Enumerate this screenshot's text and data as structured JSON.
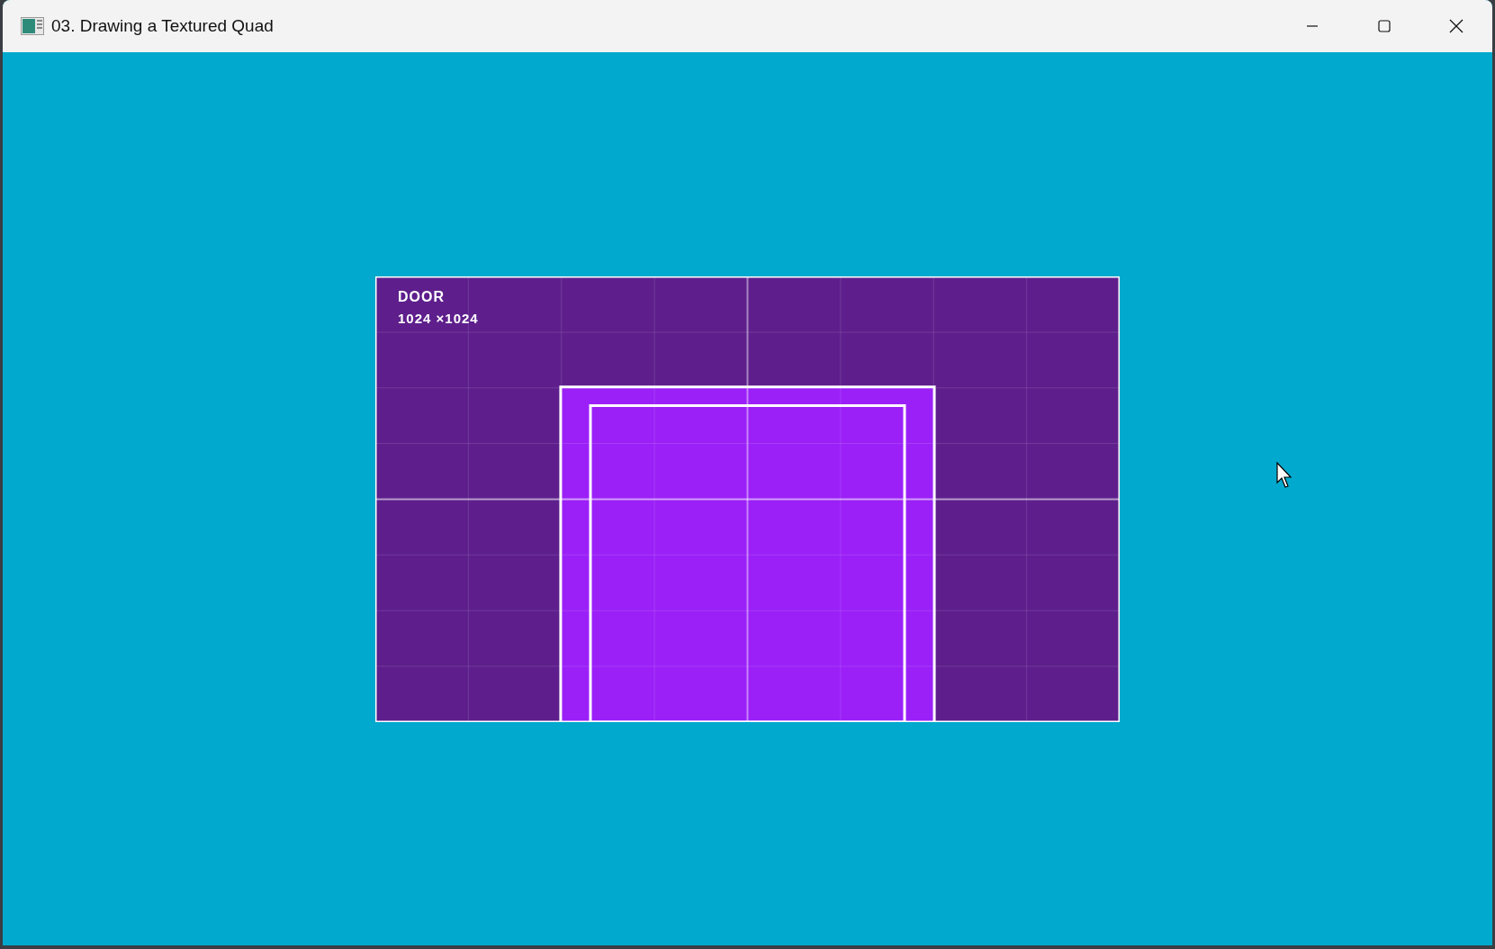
{
  "window": {
    "title": "03. Drawing a Textured Quad"
  },
  "texture": {
    "name": "DOOR",
    "size": "1024 ×1024"
  }
}
